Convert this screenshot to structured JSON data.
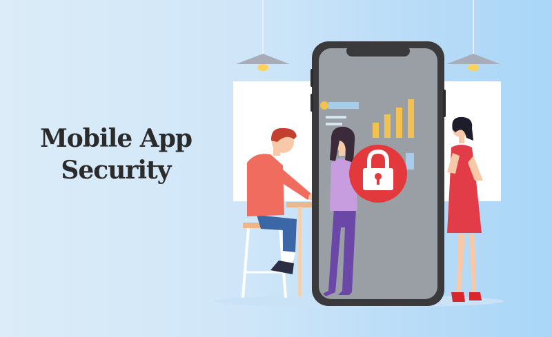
{
  "headline": {
    "line1": "Mobile App",
    "line2": "Security"
  },
  "illustration": {
    "center_icon": "padlock-icon",
    "colors": {
      "background": "#cfe6f8",
      "phone_frame": "#3a3a3c",
      "lock_circle": "#e3393c",
      "chart_bars": "#f2c14e",
      "headline_text": "#2b2b2b"
    }
  }
}
